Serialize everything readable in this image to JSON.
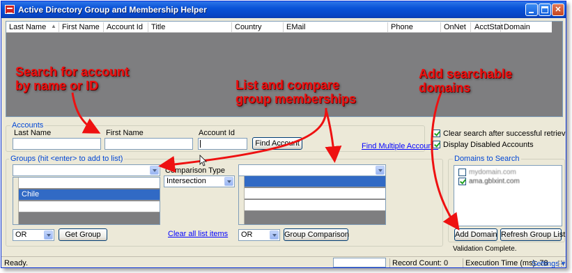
{
  "window": {
    "title": "Active Directory Group and Membership Helper",
    "min_label": "",
    "max_label": "",
    "close_label": "✕"
  },
  "grid": {
    "columns": [
      "Last Name",
      "First Name",
      "Account Id",
      "Title",
      "Country",
      "EMail",
      "Phone",
      "OnNet",
      "AcctStat",
      "Domain"
    ]
  },
  "accounts": {
    "legend": "Accounts",
    "last_name_label": "Last Name",
    "first_name_label": "First Name",
    "account_id_label": "Account Id",
    "last_name_value": "",
    "first_name_value": "",
    "account_id_value": "",
    "find_button": "Find Account",
    "find_multiple_link": "Find Multiple Accounts"
  },
  "options": {
    "clear_search": {
      "label": "Clear search after successful retrieval",
      "checked": true
    },
    "display_disabled": {
      "label": "Display Disabled Accounts",
      "checked": true
    }
  },
  "groups": {
    "legend": "Groups (hit <enter> to add to list)",
    "left_combo_value": "",
    "left_list": [
      "",
      "Chile",
      "",
      ""
    ],
    "left_selected_index": 1,
    "comparison_type_label": "Comparison Type",
    "comparison_type_value": "Intersection",
    "right_combo_value": "",
    "right_list": [
      "",
      "",
      ""
    ],
    "right_selected_index": 0,
    "left_operator": "OR",
    "get_group_button": "Get Group",
    "clear_link": "Clear all  list items",
    "right_operator": "OR",
    "group_comparison_button": "Group Comparison"
  },
  "domains": {
    "legend": "Domains to Search",
    "items": [
      {
        "label": "mydomain.com",
        "checked": false
      },
      {
        "label": "ama.gblxint.com",
        "checked": true
      }
    ],
    "add_button": "Add Domain",
    "refresh_button": "Refresh Group List",
    "validation": "Validation Complete."
  },
  "status": {
    "ready": "Ready.",
    "record_count": "Record Count: 0",
    "execution_time": "Execution Time (ms): 78",
    "settings": "Settings",
    "settings_arrow": "▾"
  },
  "annotations": {
    "search": "Search for account\nby name or ID",
    "compare": "List and compare\ngroup memberships",
    "domains": "Add searchable\ndomains"
  },
  "colors": {
    "annotation_red": "#ee1111",
    "legend_blue": "#0046d5",
    "selection_blue": "#316ac5",
    "titlebar_blue": "#0a53d8"
  }
}
